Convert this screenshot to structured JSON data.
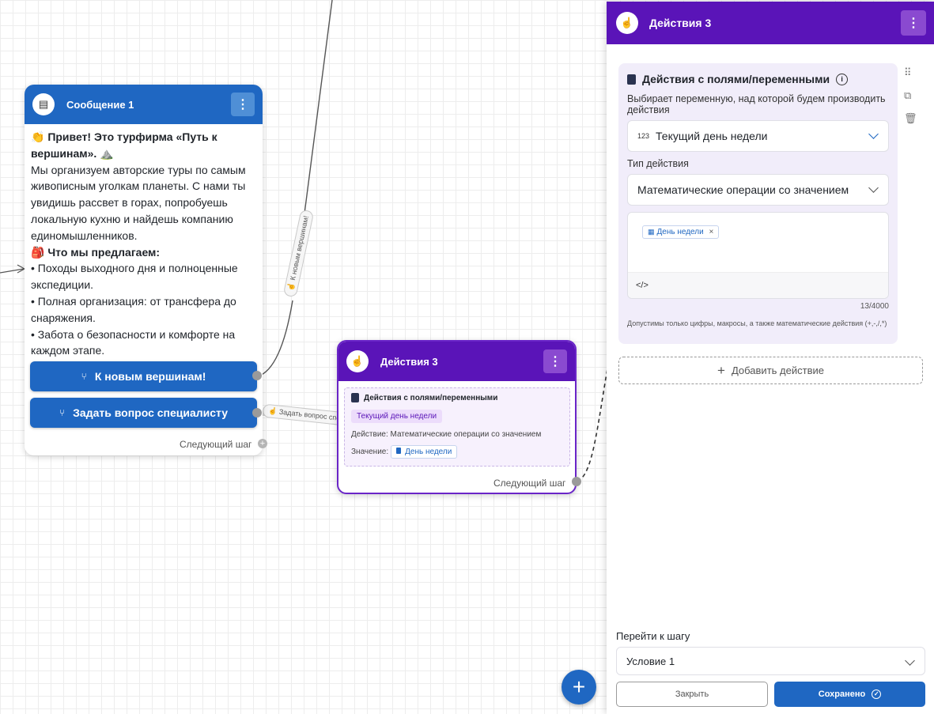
{
  "message_node": {
    "title": "Сообщение 1",
    "greeting_bold": "👏 Привет! Это турфирма «Путь к вершинам». ⛰️",
    "intro": "Мы организуем авторские туры по самым живописным уголкам планеты. С нами ты увидишь рассвет в горах, попробуешь локальную кухню и найдешь компанию единомышленников.",
    "offer_bold": "🎒 Что мы предлагаем:",
    "bullet_1": "• Походы выходного дня и полноценные экспедиции.",
    "bullet_2": "• Полная организация: от трансфера до снаряжения.",
    "bullet_3": "• Забота о безопасности и комфорте на каждом этапе.",
    "button_1": "К новым вершинам!",
    "button_2": "Задать вопрос специалисту",
    "next_step": "Следующий шаг"
  },
  "edges": {
    "label_1": "К новым вершинам!",
    "label_2": "Задать вопрос спе"
  },
  "action_node": {
    "title": "Действия 3",
    "card_title": "Действия с полями/переменными",
    "variable_chip": "Текущий день недели",
    "action_line": "Действие: Математические операции со значением",
    "value_label": "Значение:",
    "value_chip": "День недели",
    "next_step": "Следующий шаг"
  },
  "panel": {
    "title": "Действия 3",
    "card_title": "Действия с полями/переменными",
    "description": "Выбирает переменную, над которой будем производить действия",
    "variable_prefix": "123",
    "variable_value": "Текущий день недели",
    "action_type_label": "Тип действия",
    "action_type_value": "Математические операции со значением",
    "editor_chip": "День недели",
    "editor_code_icon": "</>",
    "counter": "13/4000",
    "hint": "Допустимы только цифры, макросы, а также математические действия (+,-,/,*)",
    "add_action": "Добавить действие",
    "goto_label": "Перейти к шагу",
    "goto_value": "Условие 1",
    "close_button": "Закрыть",
    "save_button": "Сохранено"
  },
  "colors": {
    "primary_blue": "#1f67c2",
    "action_purple": "#5a14b8",
    "card_bg": "#f1edfa"
  }
}
